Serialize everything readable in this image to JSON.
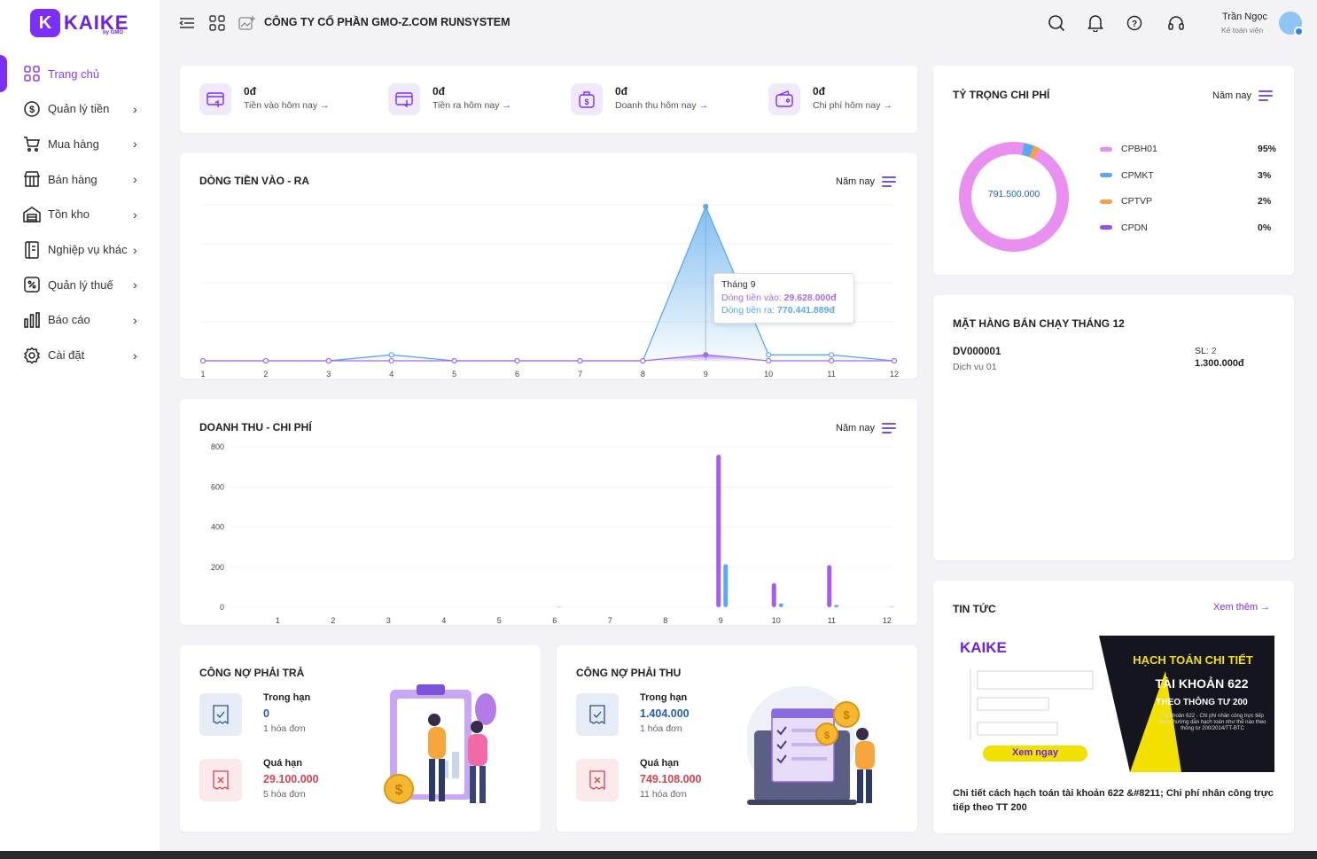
{
  "brand": {
    "logo_text": "KAIKE",
    "logo_sub": "by GMO",
    "accent": "#7b2ff7"
  },
  "sidebar": {
    "items": [
      {
        "label": "Trang chủ",
        "icon": "home-grid-icon",
        "active": true
      },
      {
        "label": "Quản lý tiền",
        "icon": "dollar-circle-icon"
      },
      {
        "label": "Mua hàng",
        "icon": "cart-icon"
      },
      {
        "label": "Bán hàng",
        "icon": "shop-icon"
      },
      {
        "label": "Tồn kho",
        "icon": "warehouse-icon"
      },
      {
        "label": "Nghiệp vụ khác",
        "icon": "notebook-icon"
      },
      {
        "label": "Quản lý thuế",
        "icon": "tax-icon"
      },
      {
        "label": "Báo cáo",
        "icon": "bar-chart-icon"
      },
      {
        "label": "Cài đặt",
        "icon": "gear-icon"
      }
    ]
  },
  "header": {
    "company": "CÔNG TY CỔ PHẦN GMO-Z.COM RUNSYSTEM",
    "user_name": "Trần Ngọc",
    "user_role": "Kế toán viên"
  },
  "stats": [
    {
      "value": "0đ",
      "label": "Tiền vào hôm nay",
      "icon": "card-in-icon"
    },
    {
      "value": "0đ",
      "label": "Tiền ra hôm nay",
      "icon": "card-out-icon"
    },
    {
      "value": "0đ",
      "label": "Doanh thu hôm nay",
      "icon": "money-bag-icon"
    },
    {
      "value": "0đ",
      "label": "Chi phí hôm nay",
      "icon": "wallet-icon"
    }
  ],
  "arrow": "→",
  "cashflow": {
    "title": "DÒNG TIỀN VÀO - RA",
    "period": "Năm nay",
    "tooltip": {
      "title": "Tháng 9",
      "in_label": "Dòng tiền vào:",
      "in_value": "29.628.000đ",
      "out_label": "Dòng tiền ra:",
      "out_value": "770.441.889đ"
    }
  },
  "revenue": {
    "title": "DOANH THU - CHI PHÍ",
    "period": "Năm nay"
  },
  "expense_share": {
    "title": "TỶ TRỌNG CHI PHÍ",
    "period": "Năm nay",
    "total": "791.500.000",
    "legend": [
      {
        "name": "CPBH01",
        "pct": "95%",
        "color": "#e98ff0"
      },
      {
        "name": "CPMKT",
        "pct": "3%",
        "color": "#5aa9ee"
      },
      {
        "name": "CPTVP",
        "pct": "2%",
        "color": "#f5a04a"
      },
      {
        "name": "CPDN",
        "pct": "0%",
        "color": "#9b4fe8"
      }
    ]
  },
  "best_seller": {
    "title": "MẶT HÀNG BÁN CHẠY THÁNG 12",
    "code": "DV000001",
    "name": "Dịch vụ 01",
    "qty_label": "SL:",
    "qty": "2",
    "amount": "1.300.000đ"
  },
  "payable": {
    "title": "CÔNG NỢ PHẢI TRẢ",
    "due_label": "Trong hạn",
    "due_value": "0",
    "due_count": "1 hóa đơn",
    "overdue_label": "Quá hạn",
    "overdue_value": "29.100.000",
    "overdue_count": "5 hóa đơn"
  },
  "receivable": {
    "title": "CÔNG NỢ PHẢI THU",
    "due_label": "Trong hạn",
    "due_value": "1.404.000",
    "due_count": "1 hóa đơn",
    "overdue_label": "Quá hạn",
    "overdue_value": "749.108.000",
    "overdue_count": "11 hóa đơn"
  },
  "news": {
    "title": "TIN TỨC",
    "more": "Xem thêm →",
    "banner": {
      "logo": "KAIKE",
      "line1": "HẠCH TOÁN CHI TIẾT",
      "line2": "TÀI KHOẢN 622",
      "line3": "THEO THÔNG TƯ 200",
      "desc": "Tài khoản 622 - Chi phí nhân công trực tiếp được hướng dẫn hạch toán như thế nào theo thông tư 200/2014/TT-BTC",
      "cta": "Xem ngay"
    },
    "headline": "Chi tiết cách hạch toán tài khoản 622 &#8211; Chi phí nhân công trực tiếp theo TT 200"
  },
  "chart_data": [
    {
      "type": "line",
      "title": "DÒNG TIỀN VÀO - RA",
      "x": [
        1,
        2,
        3,
        4,
        5,
        6,
        7,
        8,
        9,
        10,
        11,
        12
      ],
      "series": [
        {
          "values": [
            0,
            0,
            0,
            29.6,
            0,
            0,
            0,
            0,
            770.4,
            29.6,
            29.6,
            0
          ],
          "color": "#5aa9ee"
        },
        {
          "values": [
            0,
            0,
            0,
            0,
            0,
            0,
            0,
            0,
            29.6,
            0,
            0,
            0
          ],
          "color": "#a66cf0"
        }
      ]
    },
    {
      "type": "bar",
      "title": "DOANH THU - CHI PHÍ",
      "categories": [
        1,
        2,
        3,
        4,
        5,
        6,
        7,
        8,
        9,
        10,
        11,
        12
      ],
      "ylim": [
        0,
        800
      ],
      "yticks": [
        0,
        200,
        400,
        600,
        800
      ],
      "series": [
        {
          "values": [
            0,
            0,
            0,
            0,
            0,
            0,
            0,
            0,
            760,
            120,
            210,
            0
          ],
          "color": "#a45cf2"
        },
        {
          "values": [
            0,
            0,
            0,
            0,
            0,
            2,
            0,
            0,
            215,
            20,
            12,
            2
          ],
          "color": "#5aa9ee"
        }
      ]
    },
    {
      "type": "pie",
      "title": "TỶ TRỌNG CHI PHÍ",
      "categories": [
        "CPBH01",
        "CPMKT",
        "CPTVP",
        "CPDN"
      ],
      "values": [
        95,
        3,
        2,
        0
      ]
    }
  ]
}
